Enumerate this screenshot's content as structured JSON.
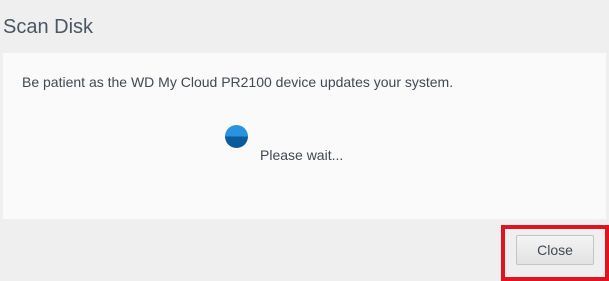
{
  "dialog": {
    "title": "Scan Disk",
    "message": "Be patient as the WD My Cloud PR2100 device updates your system.",
    "wait_text": "Please wait...",
    "spinner_icon": "loading-spinner-icon",
    "close_label": "Close"
  },
  "colors": {
    "spinner_top": "#2a93e0",
    "spinner_bottom": "#0b5b9c",
    "highlight": "#e0141e"
  }
}
